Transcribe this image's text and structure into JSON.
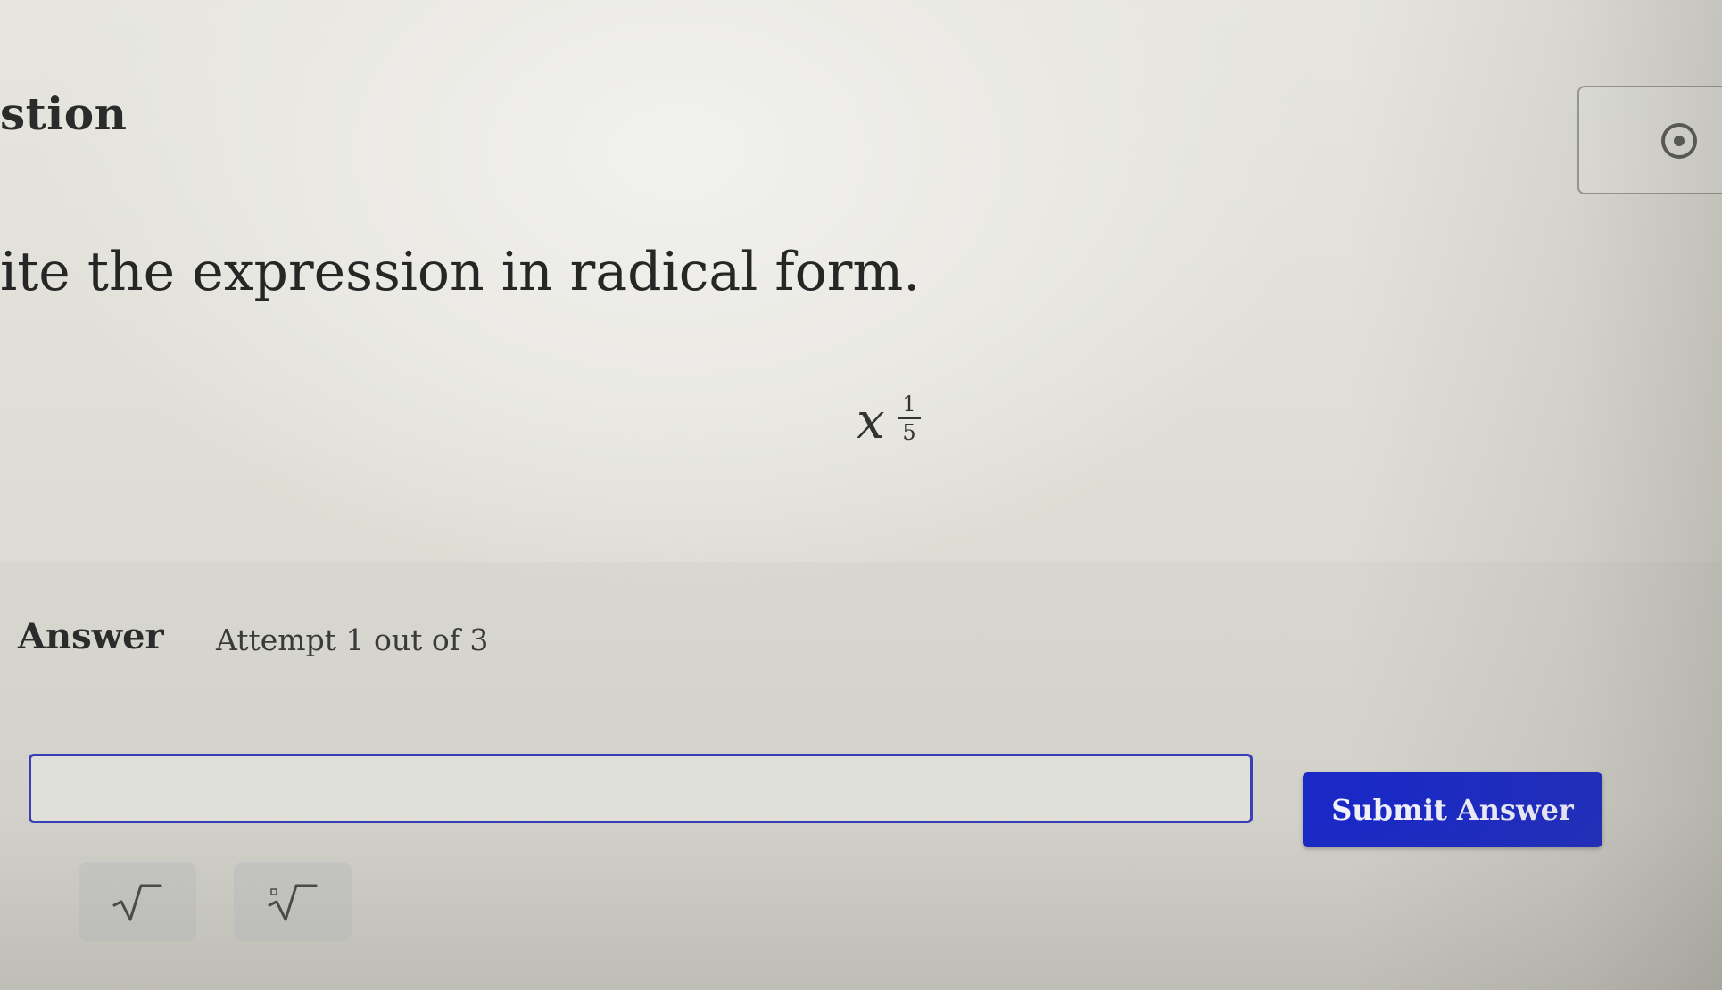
{
  "header": {
    "section_title": "stion"
  },
  "toolbar": {
    "icon": "target-icon"
  },
  "question": {
    "prompt": "ite the expression in radical form.",
    "expression_base": "x",
    "exponent_numerator": "1",
    "exponent_denominator": "5"
  },
  "answer": {
    "label": "Answer",
    "attempt_text": "Attempt 1 out of 3",
    "input_value": "",
    "submit_label": "Submit Answer"
  },
  "keypad": [
    {
      "icon": "square-root-icon"
    },
    {
      "icon": "nth-root-icon"
    }
  ],
  "colors": {
    "submit_background": "#1a29c6",
    "input_border": "#3b3fb5",
    "key_background": "#c4c6c4"
  }
}
